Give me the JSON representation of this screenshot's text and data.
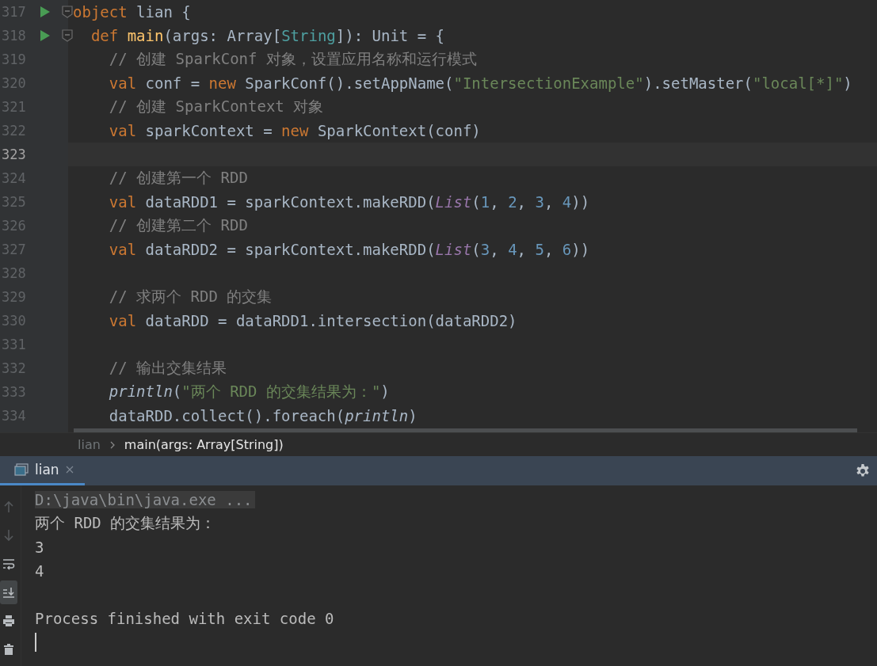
{
  "editor": {
    "lines": [
      {
        "number": "317",
        "run": true,
        "fold": true,
        "current": false,
        "tokens": [
          {
            "kind": "keyword",
            "text": "object"
          },
          {
            "kind": "plain",
            "text": " lian {"
          }
        ],
        "children": [
          {
            "number": "318",
            "run": true,
            "fold": true,
            "current": false,
            "tokens": [
              {
                "kind": "keyword",
                "text": "def"
              },
              {
                "kind": "function",
                "text": "main"
              },
              {
                "kind": "plain",
                "text": "(args: Array["
              },
              {
                "kind": "type",
                "text": "String"
              },
              {
                "kind": "plain",
                "text": "]): Unit = {"
              }
            ],
            "children": [
              {
                "number": "319",
                "current": false,
                "tokens": [
                  {
                    "kind": "comment",
                    "text": "// 创建 SparkConf 对象，设置应用名称和运行模式"
                  }
                ]
              },
              {
                "number": "320",
                "current": false,
                "tokens": [
                  {
                    "kind": "keyword",
                    "text": "val"
                  },
                  {
                    "kind": "plain",
                    "text": " conf = "
                  },
                  {
                    "kind": "keyword",
                    "text": "new"
                  },
                  {
                    "kind": "plain",
                    "text": " SparkConf().setAppName("
                  },
                  {
                    "kind": "string",
                    "text": "\"IntersectionExample\""
                  },
                  {
                    "kind": "plain",
                    "text": ").setMaster("
                  },
                  {
                    "kind": "string",
                    "text": "\"local[*]\""
                  },
                  {
                    "kind": "plain",
                    "text": ")"
                  }
                ]
              },
              {
                "number": "321",
                "current": false,
                "tokens": [
                  {
                    "kind": "comment",
                    "text": "// 创建 SparkContext 对象"
                  }
                ]
              },
              {
                "number": "322",
                "current": false,
                "tokens": [
                  {
                    "kind": "keyword",
                    "text": "val"
                  },
                  {
                    "kind": "plain",
                    "text": " sparkContext = "
                  },
                  {
                    "kind": "keyword",
                    "text": "new"
                  },
                  {
                    "kind": "plain",
                    "text": " SparkContext(conf)"
                  }
                ]
              },
              {
                "number": "323",
                "current": true
              },
              {
                "number": "324",
                "current": false,
                "tokens": [
                  {
                    "kind": "comment",
                    "text": "// 创建第一个 RDD"
                  }
                ]
              },
              {
                "number": "325",
                "current": false,
                "tokens": [
                  {
                    "kind": "keyword",
                    "text": "val"
                  },
                  {
                    "kind": "plain",
                    "text": " dataRDD1 = sparkContext.makeRDD("
                  },
                  {
                    "kind": "collection",
                    "text": "List"
                  },
                  {
                    "kind": "plain",
                    "text": "("
                  },
                  {
                    "kind": "number",
                    "text": "1"
                  },
                  {
                    "kind": "plain",
                    "text": ", "
                  },
                  {
                    "kind": "number",
                    "text": "2"
                  },
                  {
                    "kind": "plain",
                    "text": ", "
                  },
                  {
                    "kind": "number",
                    "text": "3"
                  },
                  {
                    "kind": "plain",
                    "text": ", "
                  },
                  {
                    "kind": "number",
                    "text": "4"
                  },
                  {
                    "kind": "plain",
                    "text": "))"
                  }
                ]
              },
              {
                "number": "326",
                "current": false,
                "tokens": [
                  {
                    "kind": "comment",
                    "text": "// 创建第二个 RDD"
                  }
                ]
              },
              {
                "number": "327",
                "current": false,
                "tokens": [
                  {
                    "kind": "keyword",
                    "text": "val"
                  },
                  {
                    "kind": "plain",
                    "text": " dataRDD2 = sparkContext.makeRDD("
                  },
                  {
                    "kind": "collection",
                    "text": "List"
                  },
                  {
                    "kind": "plain",
                    "text": "("
                  },
                  {
                    "kind": "number",
                    "text": "3"
                  },
                  {
                    "kind": "plain",
                    "text": ", "
                  },
                  {
                    "kind": "number",
                    "text": "4"
                  },
                  {
                    "kind": "plain",
                    "text": ", "
                  },
                  {
                    "kind": "number",
                    "text": "5"
                  },
                  {
                    "kind": "plain",
                    "text": ", "
                  },
                  {
                    "kind": "number",
                    "text": "6"
                  },
                  {
                    "kind": "plain",
                    "text": "))"
                  }
                ]
              },
              {
                "number": "328",
                "current": false
              },
              {
                "number": "329",
                "current": false,
                "tokens": [
                  {
                    "kind": "comment",
                    "text": "// 求两个 RDD 的交集"
                  }
                ]
              },
              {
                "number": "330",
                "current": false,
                "tokens": [
                  {
                    "kind": "keyword",
                    "text": "val"
                  },
                  {
                    "kind": "plain",
                    "text": " dataRDD = dataRDD1.intersection(dataRDD2)"
                  }
                ]
              },
              {
                "number": "331",
                "current": false
              },
              {
                "number": "332",
                "current": false,
                "tokens": [
                  {
                    "kind": "comment",
                    "text": "// 输出交集结果"
                  }
                ]
              },
              {
                "number": "333",
                "current": false,
                "tokens": [
                  {
                    "kind": "call",
                    "text": "println"
                  },
                  {
                    "kind": "plain",
                    "text": "("
                  },
                  {
                    "kind": "string",
                    "text": "\"两个 RDD 的交集结果为：\""
                  },
                  {
                    "kind": "plain",
                    "text": ")"
                  }
                ]
              },
              {
                "number": "334",
                "current": false,
                "tokens": [
                  {
                    "kind": "plain",
                    "text": "dataRDD.collect().foreach("
                  },
                  {
                    "kind": "call",
                    "text": "println"
                  },
                  {
                    "kind": "plain",
                    "text": ")"
                  }
                ]
              }
            ]
          }
        ]
      }
    ]
  },
  "breadcrumb": [
    {
      "text": "lian",
      "selected": false
    },
    {
      "text": "main(args: Array[String])",
      "selected": true
    }
  ],
  "run_panel": {
    "tabs": [
      {
        "label": "lian",
        "selected": true
      }
    ],
    "toolbar": [
      {
        "kind": "up",
        "disabled": true,
        "selected": false
      },
      {
        "kind": "down",
        "disabled": true,
        "selected": false
      },
      {
        "kind": "wrap",
        "disabled": false,
        "selected": false
      },
      {
        "kind": "scroll-end",
        "disabled": false,
        "selected": true
      },
      {
        "kind": "print",
        "disabled": false,
        "selected": false
      },
      {
        "kind": "trash",
        "disabled": false,
        "selected": false
      }
    ],
    "console": [
      {
        "kind": "command",
        "text": "D:\\java\\bin\\java.exe ..."
      },
      {
        "kind": "output",
        "text": "两个 RDD 的交集结果为："
      },
      {
        "kind": "output",
        "text": "3"
      },
      {
        "kind": "output",
        "text": "4"
      },
      {
        "kind": "blank"
      },
      {
        "kind": "output",
        "text": "Process finished with exit code 0"
      },
      {
        "kind": "cursor"
      }
    ]
  }
}
